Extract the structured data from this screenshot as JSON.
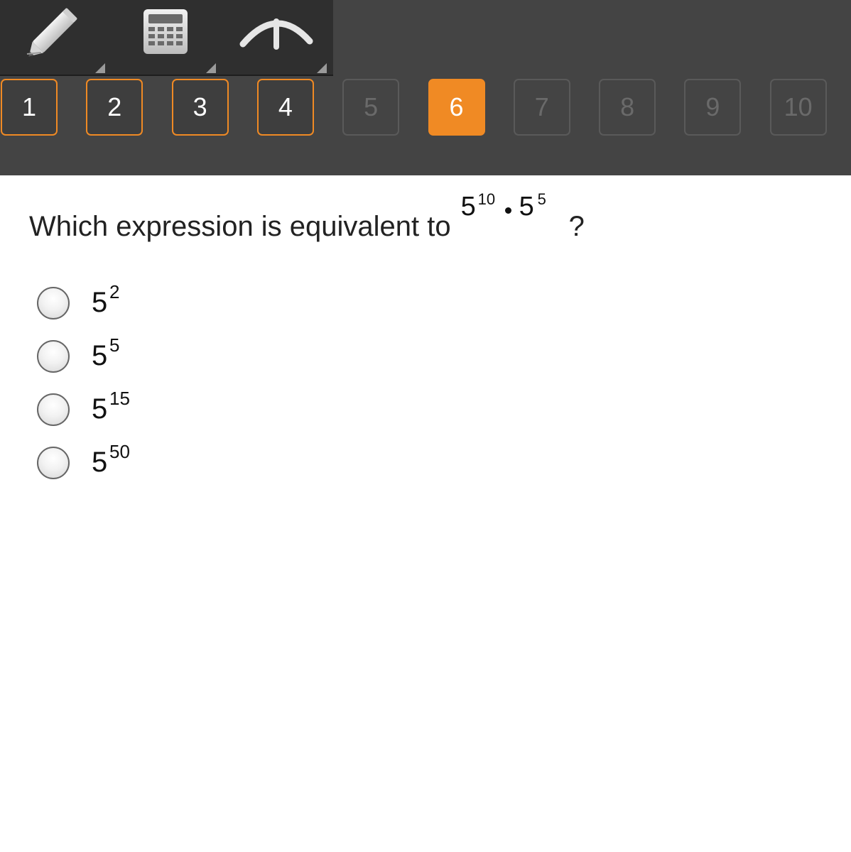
{
  "toolbar": {
    "tools": [
      {
        "name": "pencil-icon"
      },
      {
        "name": "calculator-icon"
      },
      {
        "name": "reference-icon"
      }
    ]
  },
  "nav": {
    "questions": [
      {
        "label": "1",
        "state": "answered"
      },
      {
        "label": "2",
        "state": "answered"
      },
      {
        "label": "3",
        "state": "answered"
      },
      {
        "label": "4",
        "state": "answered"
      },
      {
        "label": "5",
        "state": "unanswered"
      },
      {
        "label": "6",
        "state": "current"
      },
      {
        "label": "7",
        "state": "unanswered"
      },
      {
        "label": "8",
        "state": "unanswered"
      },
      {
        "label": "9",
        "state": "unanswered"
      },
      {
        "label": "10",
        "state": "unanswered"
      }
    ]
  },
  "question": {
    "text": "Which expression is equivalent to",
    "expression": {
      "term1_base": "5",
      "term1_exp": "10",
      "term2_base": "5",
      "term2_exp": "5"
    },
    "end": "?"
  },
  "options": [
    {
      "base": "5",
      "exp": "2"
    },
    {
      "base": "5",
      "exp": "5"
    },
    {
      "base": "5",
      "exp": "15"
    },
    {
      "base": "5",
      "exp": "50"
    }
  ],
  "colors": {
    "accent": "#f08a24",
    "topbar": "#444444",
    "toolbar": "#2f2f2f"
  }
}
